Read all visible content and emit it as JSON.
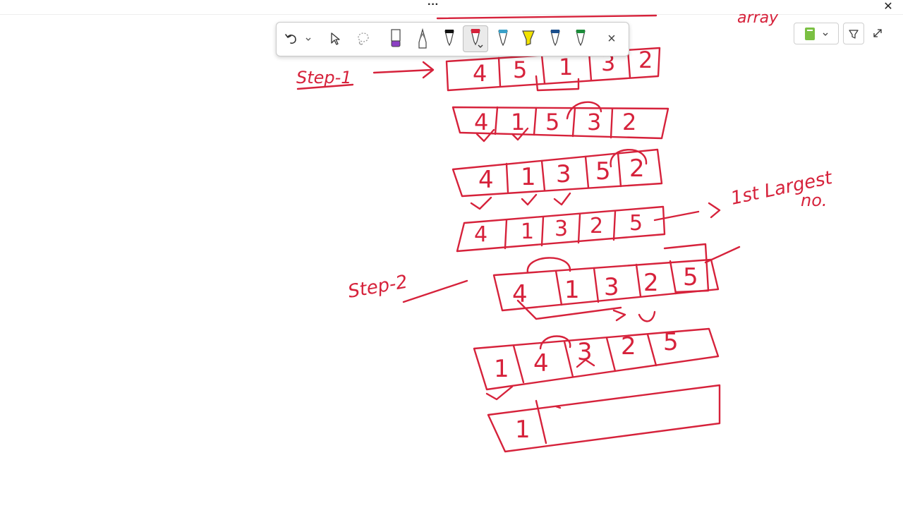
{
  "window": {
    "more_glyph": "···",
    "close_glyph": "✕"
  },
  "toolbar": {
    "undo_label": "Undo",
    "close_glyph": "×",
    "pens": [
      {
        "name": "purple-highlighter",
        "color": "#8b3fc4"
      },
      {
        "name": "pencil",
        "color": "#7a7a7a"
      },
      {
        "name": "black-pen",
        "color": "#111111"
      },
      {
        "name": "red-pen",
        "color": "#d6223b",
        "selected": true
      },
      {
        "name": "blue-pen",
        "color": "#3aa0c8"
      },
      {
        "name": "yellow-highlighter",
        "color": "#f2e200"
      },
      {
        "name": "navy-pen",
        "color": "#1b4f8c"
      },
      {
        "name": "green-pen",
        "color": "#1c8c3a"
      }
    ]
  },
  "right_tools": {
    "notebook_color": "#7bc043"
  },
  "ink": {
    "color": "#d6223b",
    "top_partial": "array",
    "step1_label": "Step-1",
    "step2_label": "Step-2",
    "annotation_line1": "1st Largest",
    "annotation_line2": "no.",
    "rows": [
      {
        "name": "row-0",
        "cells": [
          "4",
          "5",
          "1",
          "3",
          "2"
        ]
      },
      {
        "name": "row-1",
        "cells": [
          "4",
          "1",
          "5",
          "3",
          "2"
        ]
      },
      {
        "name": "row-2",
        "cells": [
          "4",
          "1",
          "3",
          "5",
          "2"
        ]
      },
      {
        "name": "row-3",
        "cells": [
          "4",
          "1",
          "3",
          "2",
          "5"
        ]
      },
      {
        "name": "row-4",
        "cells": [
          "4",
          "1",
          "3",
          "2",
          "5"
        ]
      },
      {
        "name": "row-5",
        "cells": [
          "1",
          "4",
          "3",
          "2",
          "5"
        ]
      },
      {
        "name": "row-6",
        "cells": [
          "1",
          "",
          "",
          "",
          ""
        ]
      }
    ]
  }
}
